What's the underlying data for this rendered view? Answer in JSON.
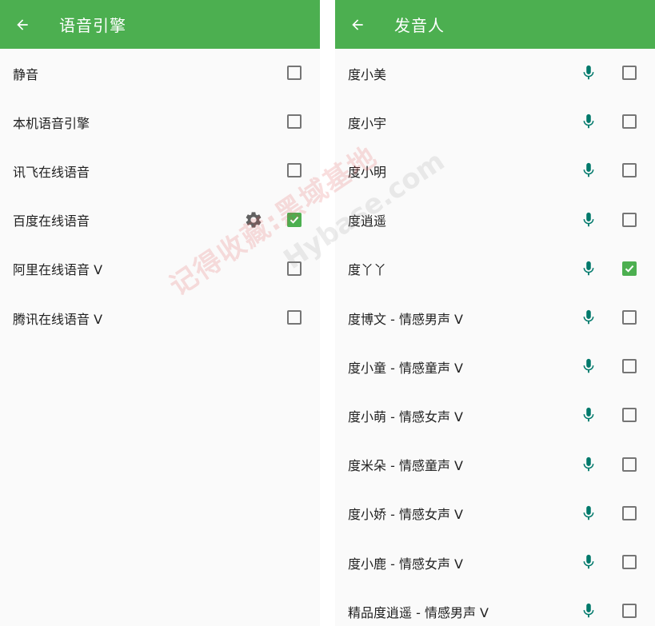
{
  "left_screen": {
    "title": "语音引擎",
    "items": [
      {
        "label": "静音",
        "checked": false
      },
      {
        "label": "本机语音引擎",
        "checked": false
      },
      {
        "label": "讯飞在线语音",
        "checked": false
      },
      {
        "label": "百度在线语音",
        "checked": true,
        "settings_icon": "gear-icon"
      },
      {
        "label": "阿里在线语音 V",
        "checked": false
      },
      {
        "label": "腾讯在线语音 V",
        "checked": false
      }
    ]
  },
  "right_screen": {
    "title": "发音人",
    "items": [
      {
        "label": "度小美",
        "checked": false
      },
      {
        "label": "度小宇",
        "checked": false
      },
      {
        "label": "度小明",
        "checked": false
      },
      {
        "label": "度逍遥",
        "checked": false
      },
      {
        "label": "度丫丫",
        "checked": true
      },
      {
        "label": "度博文 - 情感男声 V",
        "checked": false
      },
      {
        "label": "度小童 - 情感童声 V",
        "checked": false
      },
      {
        "label": "度小萌 - 情感女声 V",
        "checked": false
      },
      {
        "label": "度米朵 - 情感童声 V",
        "checked": false
      },
      {
        "label": "度小娇 - 情感女声 V",
        "checked": false
      },
      {
        "label": "度小鹿 - 情感女声 V",
        "checked": false
      },
      {
        "label": "精品度逍遥 - 情感男声 V",
        "checked": false
      }
    ]
  },
  "watermark": {
    "text_cn": "记得收藏:黑域基地",
    "text_en": "Hybase.com"
  },
  "colors": {
    "accent": "#4caf50",
    "mic_icon": "#00796b",
    "gear_icon": "#616161"
  },
  "icons": {
    "back": "arrow-left-icon",
    "settings": "gear-icon",
    "voice_preview": "microphone-icon"
  }
}
